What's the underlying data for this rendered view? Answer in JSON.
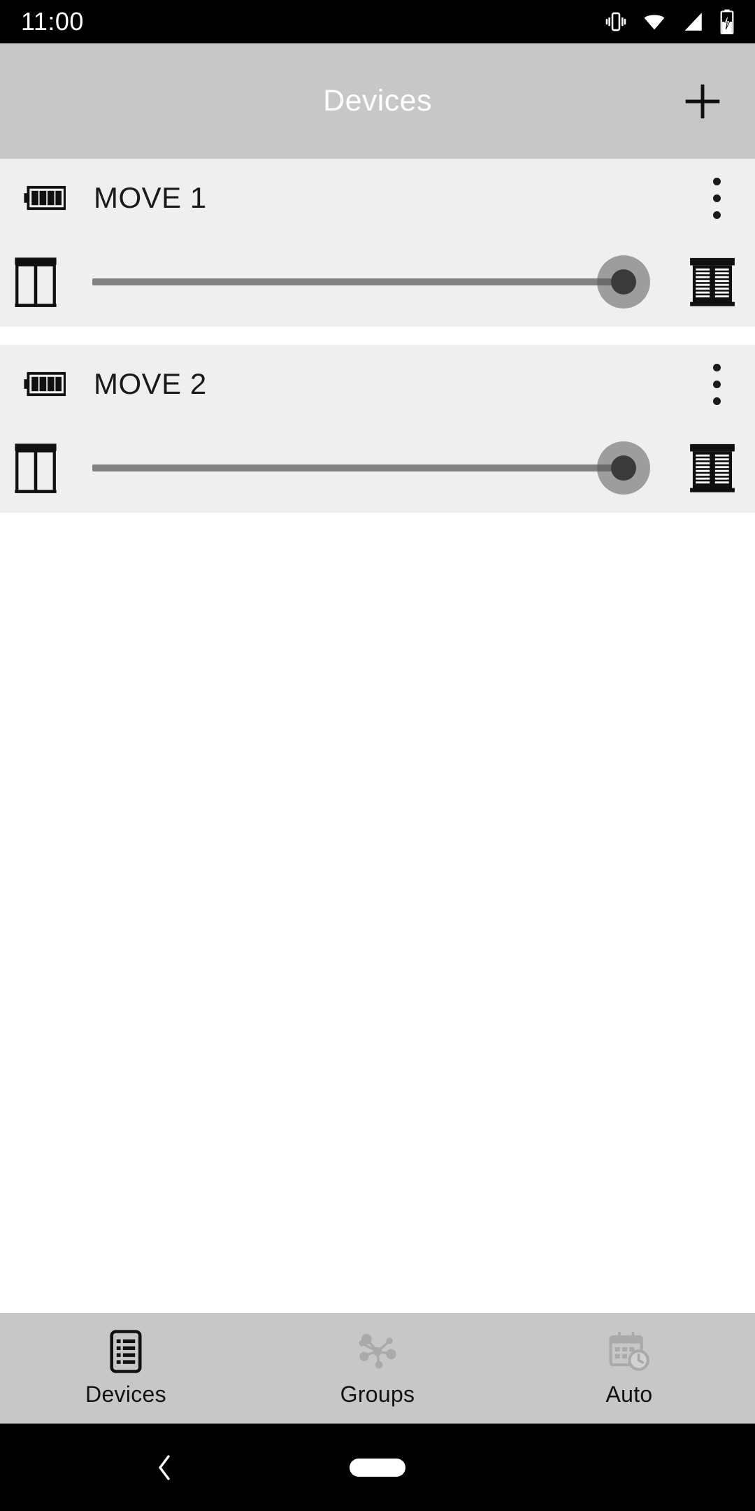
{
  "status_bar": {
    "time": "11:00",
    "icons": [
      "vibrate-icon",
      "wifi-icon",
      "signal-icon",
      "battery-charging-icon"
    ]
  },
  "app_bar": {
    "title": "Devices",
    "add_icon": "plus-icon",
    "background": "#c7c7c7",
    "title_color": "#ffffff"
  },
  "devices": [
    {
      "name": "MOVE 1",
      "battery_icon": "battery-full-icon",
      "battery_bars": 4,
      "overflow_icon": "more-vertical-icon",
      "slider": {
        "left_icon": "blinds-open-icon",
        "right_icon": "blinds-closed-icon",
        "value": 96,
        "min": 0,
        "max": 100
      }
    },
    {
      "name": "MOVE 2",
      "battery_icon": "battery-full-icon",
      "battery_bars": 4,
      "overflow_icon": "more-vertical-icon",
      "slider": {
        "left_icon": "blinds-open-icon",
        "right_icon": "blinds-closed-icon",
        "value": 96,
        "min": 0,
        "max": 100
      }
    }
  ],
  "bottom_nav": {
    "background": "#c7c7c7",
    "active_index": 0,
    "tabs": [
      {
        "label": "Devices",
        "icon": "device-list-icon",
        "active": true,
        "color": "#111111"
      },
      {
        "label": "Groups",
        "icon": "node-network-icon",
        "active": false,
        "color": "#aaaaaa"
      },
      {
        "label": "Auto",
        "icon": "calendar-clock-icon",
        "active": false,
        "color": "#aaaaaa"
      }
    ]
  },
  "system_nav": {
    "back_icon": "chevron-left-icon",
    "home_icon": "home-pill-icon",
    "background": "#000000"
  },
  "theme": {
    "card_background": "#efefef",
    "page_background": "#ffffff",
    "track_color": "#818181",
    "thumb_core_color": "#3a3a3a"
  }
}
